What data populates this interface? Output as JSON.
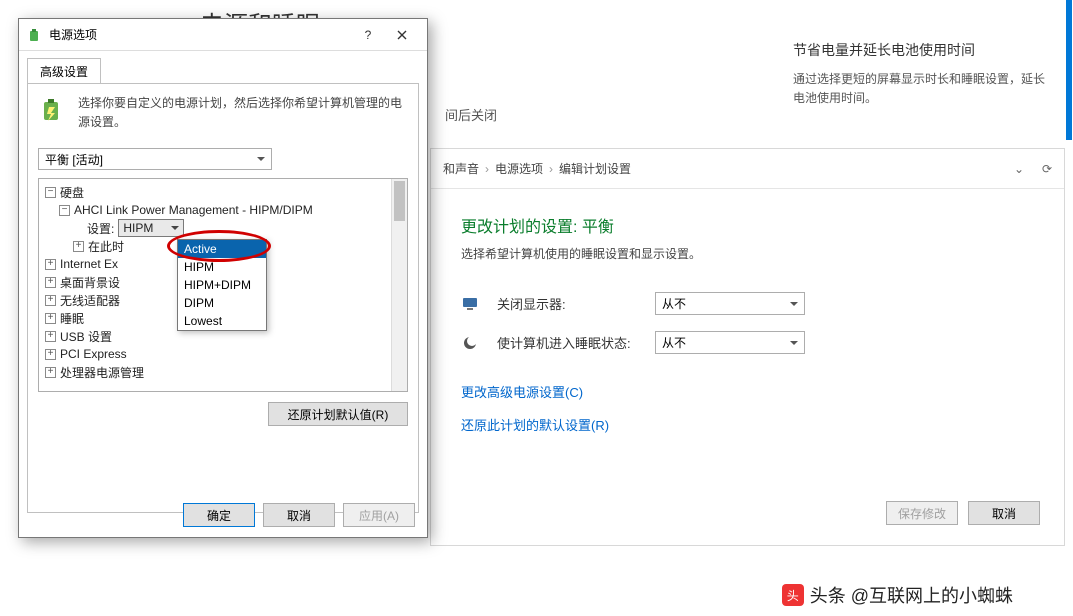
{
  "bg": {
    "partial_title": "电源和睡眠",
    "side_h": "节省电量并延长电池使用时间",
    "side_p": "通过选择更短的屏幕显示时长和睡眠设置，延长电池使用时间。",
    "snip": "间后关闭"
  },
  "explorer": {
    "crumbs": [
      "和声音",
      "电源选项",
      "编辑计划设置"
    ],
    "heading": "更改计划的设置: 平衡",
    "sub": "选择希望计算机使用的睡眠设置和显示设置。",
    "field1": "关闭显示器:",
    "field2": "使计算机进入睡眠状态:",
    "value": "从不",
    "link1": "更改高级电源设置(C)",
    "link2": "还原此计划的默认设置(R)",
    "save": "保存修改",
    "cancel": "取消"
  },
  "dialog": {
    "title": "电源选项",
    "tab": "高级设置",
    "hint": "选择你要自定义的电源计划，然后选择你希望计算机管理的电源设置。",
    "plan": "平衡 [活动]",
    "tree": {
      "disk": "硬盘",
      "ahci": "AHCI Link Power Management - HIPM/DIPM",
      "setting_label": "设置:",
      "setting_value": "HIPM",
      "after": "在此时",
      "ie": "Internet Ex",
      "desktop": "桌面背景设",
      "wifi": "无线适配器",
      "sleep": "睡眠",
      "usb": "USB 设置",
      "pci": "PCI Express",
      "cpu": "处理器电源管理"
    },
    "dropdown": [
      "Active",
      "HIPM",
      "HIPM+DIPM",
      "DIPM",
      "Lowest"
    ],
    "restore": "还原计划默认值(R)",
    "ok": "确定",
    "cancel": "取消",
    "apply": "应用(A)"
  },
  "watermark": "头条 @互联网上的小蜘蛛"
}
